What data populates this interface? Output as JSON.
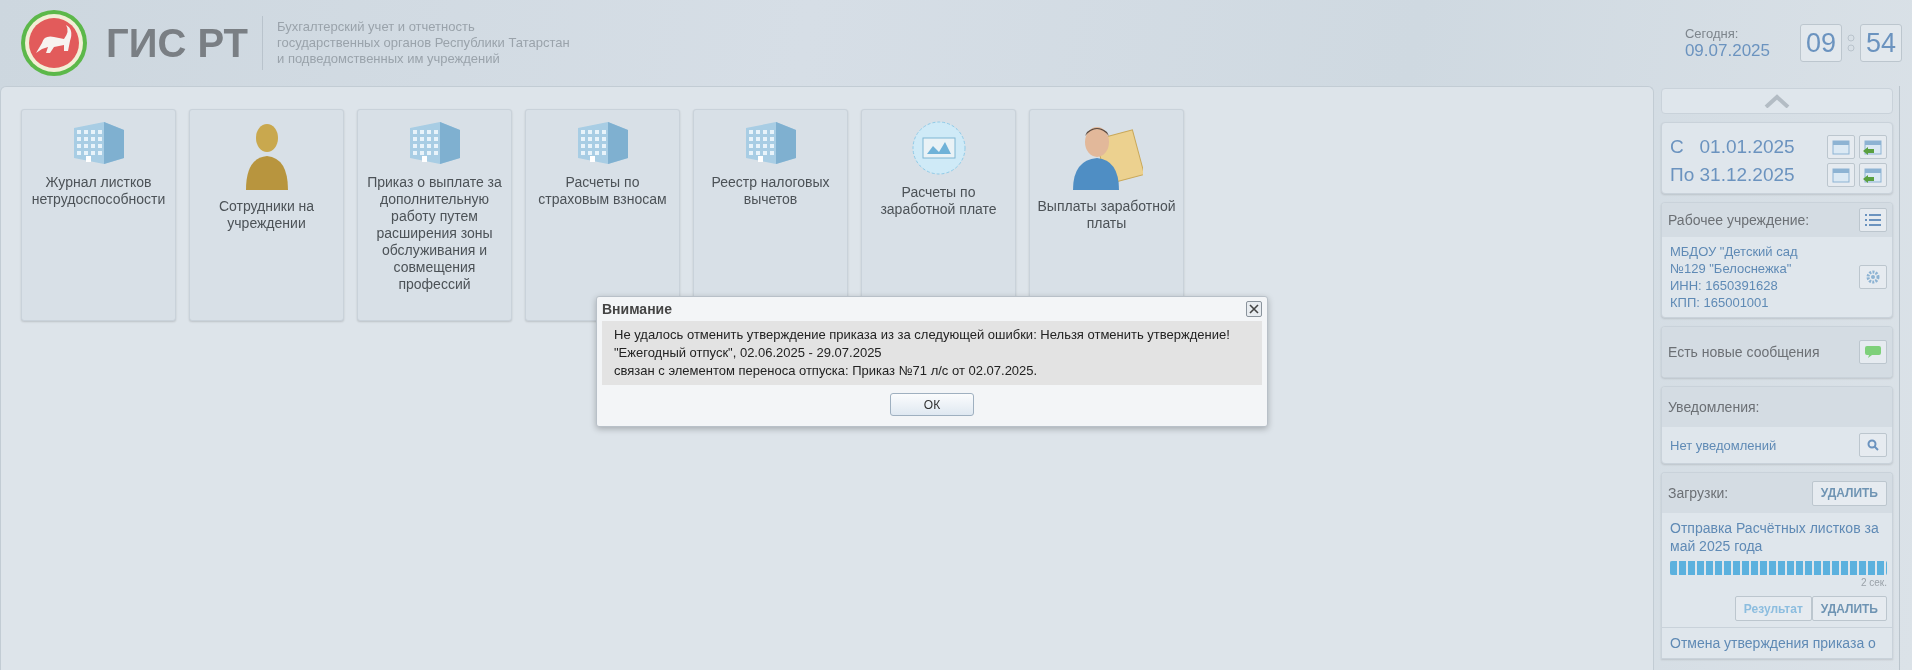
{
  "header": {
    "logo_title": "ГИС РТ",
    "subtitle": [
      "Бухгалтерский учет и отчетность",
      "государственных органов Республики Татарстан",
      "и подведомственных им учреждений"
    ],
    "today_label": "Сегодня:",
    "today_date": "09.07.2025",
    "clock_hours": "09",
    "clock_minutes": "54"
  },
  "tiles": [
    {
      "label": "Журнал листков нетрудоспособности",
      "kind": "building"
    },
    {
      "label": "Сотрудники на учреждении",
      "kind": "person"
    },
    {
      "label": "Приказ о выплате за дополнительную работу путем расширения зоны обслуживания и совмещения профессий",
      "kind": "building"
    },
    {
      "label": "Расчеты по страховым взносам",
      "kind": "building"
    },
    {
      "label": "Реестр налоговых вычетов",
      "kind": "building"
    },
    {
      "label": "Расчеты по заработной плате",
      "kind": "certificate"
    },
    {
      "label": "Выплаты заработной платы",
      "kind": "person_document"
    }
  ],
  "dialog": {
    "title": "Внимание",
    "message": [
      "Не удалось отменить утверждение приказа из за следующей ошибки: Нельзя отменить утверждение!",
      "\"Ежегодный отпуск\", 02.06.2025 - 29.07.2025",
      "связан с элементом переноса отпуска: Приказ №71 л/с от 02.07.2025."
    ],
    "ok_button": "ОК"
  },
  "sidebar": {
    "period": [
      {
        "prefix": "С",
        "date": "01.01.2025"
      },
      {
        "prefix": "По",
        "date": "31.12.2025"
      }
    ],
    "institution": {
      "label": "Рабочее учреждение:",
      "lines": [
        "МБДОУ \"Детский сад",
        "№129 \"Белоснежка\"",
        "ИНН: 1650391628",
        "КПП: 165001001"
      ]
    },
    "messages": {
      "label": "Есть новые сообщения"
    },
    "notifications": {
      "label": "Уведомления:",
      "text": "Нет уведомлений"
    },
    "downloads": {
      "label": "Загрузки:",
      "delete_button": "УДАЛИТЬ",
      "items": [
        {
          "title": "Отправка Расчётных листков за май 2025 года",
          "level": 1,
          "elapsed": "2 сек.",
          "result_button": "Результат",
          "delete_button": "УДАЛИТЬ"
        },
        {
          "title": "Отмена утверждения приказа о"
        }
      ]
    }
  }
}
